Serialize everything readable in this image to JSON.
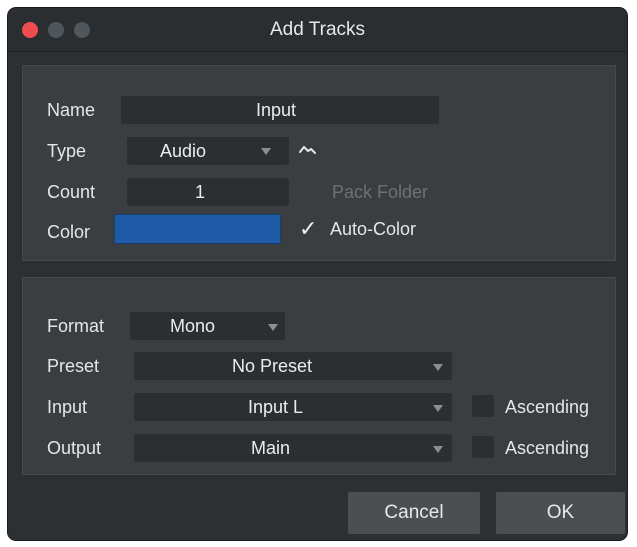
{
  "window": {
    "title": "Add Tracks"
  },
  "track": {
    "name_label": "Name",
    "name_value": "Input",
    "type_label": "Type",
    "type_value": "Audio",
    "count_label": "Count",
    "count_value": "1",
    "pack_folder_label": "Pack Folder",
    "color_label": "Color",
    "color_value": "#1f5aa6",
    "auto_color_label": "Auto-Color",
    "auto_color_checked": true
  },
  "io": {
    "format_label": "Format",
    "format_value": "Mono",
    "preset_label": "Preset",
    "preset_value": "No Preset",
    "input_label": "Input",
    "input_value": "Input L",
    "input_ascending_label": "Ascending",
    "input_ascending_checked": false,
    "output_label": "Output",
    "output_value": "Main",
    "output_ascending_label": "Ascending",
    "output_ascending_checked": false
  },
  "buttons": {
    "cancel": "Cancel",
    "ok": "OK"
  },
  "icons": {
    "close": "close-icon",
    "minimize": "minimize-icon",
    "maximize": "maximize-icon",
    "waveform": "audio-wave-icon",
    "dropdown": "chevron-down-icon",
    "check": "checkmark-icon"
  }
}
